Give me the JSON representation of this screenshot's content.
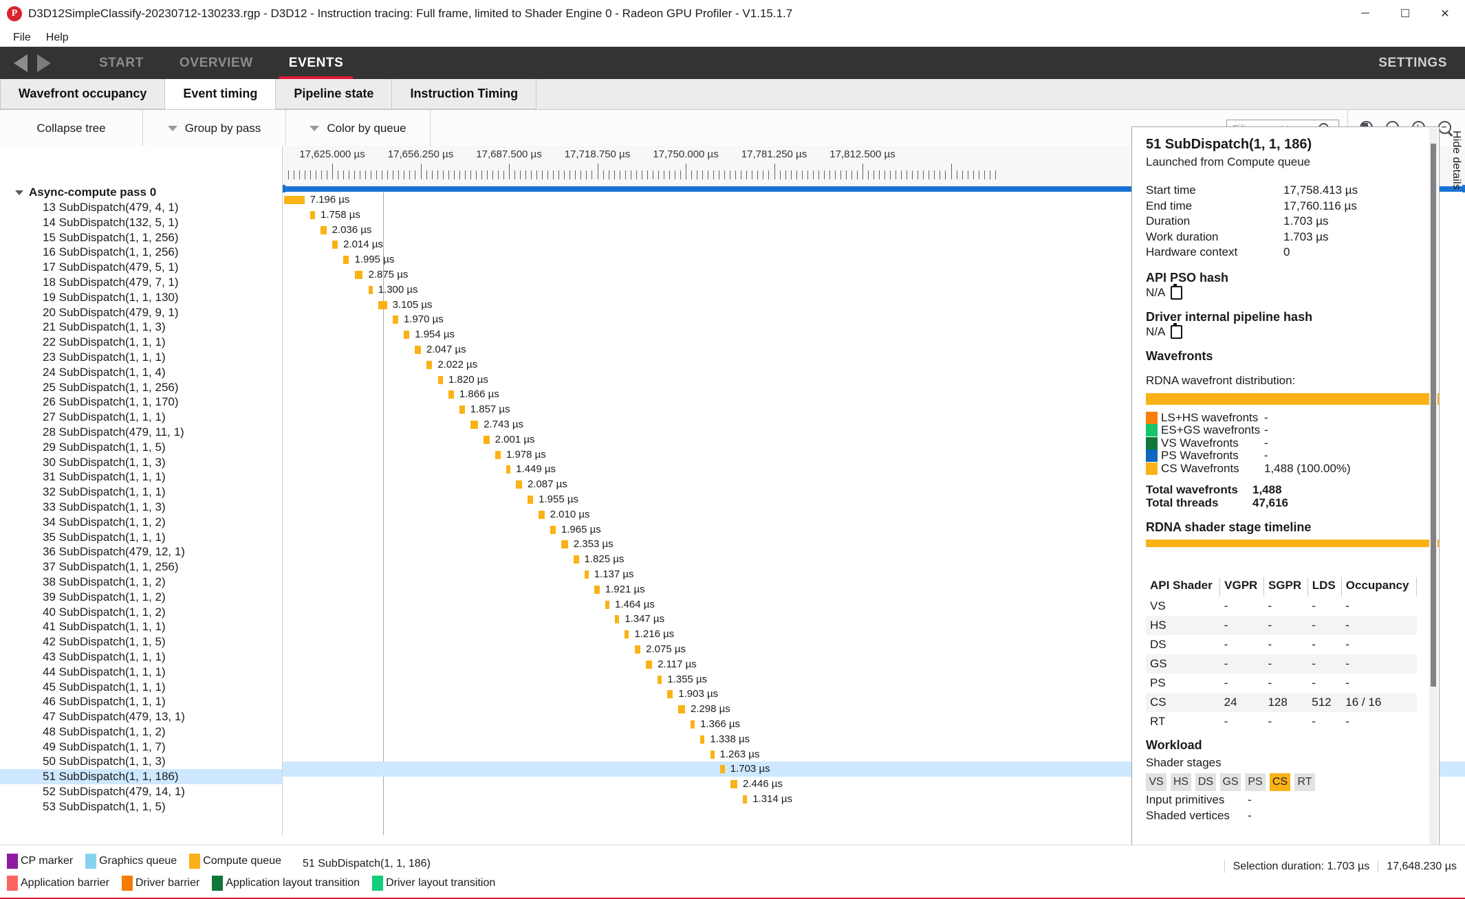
{
  "window": {
    "title": "D3D12SimpleClassify-20230712-130233.rgp - D3D12 - Instruction tracing: Full frame, limited to Shader Engine 0 - Radeon GPU Profiler - V1.15.1.7",
    "logo_letter": "P",
    "minimize": "─",
    "maximize": "☐",
    "close": "✕"
  },
  "menu": {
    "items": [
      "File",
      "Help"
    ]
  },
  "nav": {
    "back_icon": "triangle-left",
    "forward_icon": "triangle-right",
    "tabs": [
      {
        "label": "START",
        "active": false
      },
      {
        "label": "OVERVIEW",
        "active": false
      },
      {
        "label": "EVENTS",
        "active": true
      }
    ],
    "settings": "SETTINGS",
    "accent": "#e31937"
  },
  "subtabs": [
    {
      "label": "Wavefront occupancy",
      "active": false
    },
    {
      "label": "Event timing",
      "active": true
    },
    {
      "label": "Pipeline state",
      "active": false
    },
    {
      "label": "Instruction Timing",
      "active": false
    }
  ],
  "toolbar": {
    "collapse_tree": "Collapse tree",
    "group_by": "Group by pass",
    "color_by": "Color by queue",
    "search_placeholder": "Filter event tree...",
    "search_value": "",
    "zoom_buttons": [
      "zoom-to-selection-icon",
      "zoom-to-fit-icon",
      "zoom-in-icon",
      "zoom-out-icon"
    ]
  },
  "tree": {
    "root": "Async-compute pass 0",
    "selected_index": 38,
    "items": [
      "13 SubDispatch(479, 4, 1)",
      "14 SubDispatch(132, 5, 1)",
      "15 SubDispatch(1, 1, 256)",
      "16 SubDispatch(1, 1, 256)",
      "17 SubDispatch(479, 5, 1)",
      "18 SubDispatch(479, 7, 1)",
      "19 SubDispatch(1, 1, 130)",
      "20 SubDispatch(479, 9, 1)",
      "21 SubDispatch(1, 1, 3)",
      "22 SubDispatch(1, 1, 1)",
      "23 SubDispatch(1, 1, 1)",
      "24 SubDispatch(1, 1, 4)",
      "25 SubDispatch(1, 1, 256)",
      "26 SubDispatch(1, 1, 170)",
      "27 SubDispatch(1, 1, 1)",
      "28 SubDispatch(479, 11, 1)",
      "29 SubDispatch(1, 1, 5)",
      "30 SubDispatch(1, 1, 3)",
      "31 SubDispatch(1, 1, 1)",
      "32 SubDispatch(1, 1, 1)",
      "33 SubDispatch(1, 1, 3)",
      "34 SubDispatch(1, 1, 2)",
      "35 SubDispatch(1, 1, 1)",
      "36 SubDispatch(479, 12, 1)",
      "37 SubDispatch(1, 1, 256)",
      "38 SubDispatch(1, 1, 2)",
      "39 SubDispatch(1, 1, 2)",
      "40 SubDispatch(1, 1, 2)",
      "41 SubDispatch(1, 1, 1)",
      "42 SubDispatch(1, 1, 5)",
      "43 SubDispatch(1, 1, 1)",
      "44 SubDispatch(1, 1, 1)",
      "45 SubDispatch(1, 1, 1)",
      "46 SubDispatch(1, 1, 1)",
      "47 SubDispatch(479, 13, 1)",
      "48 SubDispatch(1, 1, 2)",
      "49 SubDispatch(1, 1, 7)",
      "50 SubDispatch(1, 1, 3)",
      "51 SubDispatch(1, 1, 186)",
      "52 SubDispatch(479, 14, 1)",
      "53 SubDispatch(1, 1, 5)"
    ]
  },
  "timeline": {
    "ruler_labels": [
      "17,625.000 µs",
      "17,656.250 µs",
      "17,687.500 µs",
      "17,718.750 µs",
      "17,750.000 µs",
      "17,781.250 µs",
      "17,812.500 µs"
    ],
    "bar_color": "#fbb216",
    "range_color": "#1a73d4",
    "durations": [
      "7.196 µs",
      "1.758 µs",
      "2.036 µs",
      "2.014 µs",
      "1.995 µs",
      "2.875 µs",
      "1.300 µs",
      "3.105 µs",
      "1.970 µs",
      "1.954 µs",
      "2.047 µs",
      "2.022 µs",
      "1.820 µs",
      "1.866 µs",
      "1.857 µs",
      "2.743 µs",
      "2.001 µs",
      "1.978 µs",
      "1.449 µs",
      "2.087 µs",
      "1.955 µs",
      "2.010 µs",
      "1.965 µs",
      "2.353 µs",
      "1.825 µs",
      "1.137 µs",
      "1.921 µs",
      "1.464 µs",
      "1.347 µs",
      "1.216 µs",
      "2.075 µs",
      "2.117 µs",
      "1.355 µs",
      "1.903 µs",
      "2.298 µs",
      "1.366 µs",
      "1.338 µs",
      "1.263 µs",
      "1.703 µs",
      "2.446 µs",
      "1.314 µs"
    ]
  },
  "details": {
    "title": "51 SubDispatch(1, 1, 186)",
    "subtitle": "Launched from Compute queue",
    "fields": [
      {
        "label": "Start time",
        "value": "17,758.413 µs"
      },
      {
        "label": "End time",
        "value": "17,760.116 µs"
      },
      {
        "label": "Duration",
        "value": "1.703 µs"
      },
      {
        "label": "Work duration",
        "value": "1.703 µs"
      },
      {
        "label": "Hardware context",
        "value": "0"
      }
    ],
    "api_pso_hash_label": "API PSO hash",
    "api_pso_hash_value": "N/A",
    "driver_hash_label": "Driver internal pipeline hash",
    "driver_hash_value": "N/A",
    "wavefronts_header": "Wavefronts",
    "distribution_label": "RDNA wavefront distribution:",
    "wavefront_legend": [
      {
        "color": "#f87f09",
        "name": "LS+HS wavefronts",
        "value": "-"
      },
      {
        "color": "#14c46a",
        "name": "ES+GS wavefronts",
        "value": "-"
      },
      {
        "color": "#10773a",
        "name": "VS Wavefronts",
        "value": "-"
      },
      {
        "color": "#0b68bd",
        "name": "PS Wavefronts",
        "value": "-"
      },
      {
        "color": "#fbb216",
        "name": "CS Wavefronts",
        "value": "1,488 (100.00%)"
      }
    ],
    "totals": [
      {
        "label": "Total wavefronts",
        "value": "1,488"
      },
      {
        "label": "Total threads",
        "value": "47,616"
      }
    ],
    "stage_timeline_header": "RDNA shader stage timeline",
    "shader_table": {
      "columns": [
        "API Shader",
        "VGPR",
        "SGPR",
        "LDS",
        "Occupancy"
      ],
      "rows": [
        [
          "VS",
          "-",
          "-",
          "-",
          "-"
        ],
        [
          "HS",
          "-",
          "-",
          "-",
          "-"
        ],
        [
          "DS",
          "-",
          "-",
          "-",
          "-"
        ],
        [
          "GS",
          "-",
          "-",
          "-",
          "-"
        ],
        [
          "PS",
          "-",
          "-",
          "-",
          "-"
        ],
        [
          "CS",
          "24",
          "128",
          "512",
          "16 / 16"
        ],
        [
          "RT",
          "-",
          "-",
          "-",
          "-"
        ]
      ]
    },
    "workload_header": "Workload",
    "shader_stages_label": "Shader stages",
    "stage_chips": [
      {
        "label": "VS",
        "active": false
      },
      {
        "label": "HS",
        "active": false
      },
      {
        "label": "DS",
        "active": false
      },
      {
        "label": "GS",
        "active": false
      },
      {
        "label": "PS",
        "active": false
      },
      {
        "label": "CS",
        "active": true
      },
      {
        "label": "RT",
        "active": false
      }
    ],
    "workload_rows": [
      {
        "label": "Input primitives",
        "value": "-"
      },
      {
        "label": "Shaded vertices",
        "value": "-"
      }
    ],
    "hide_details": "Hide details"
  },
  "bottom": {
    "legend_row1": [
      {
        "color": "#8e1ba0",
        "label": "CP marker"
      },
      {
        "color": "#85d3ef",
        "label": "Graphics queue"
      },
      {
        "color": "#fbb216",
        "label": "Compute queue"
      }
    ],
    "legend_row2": [
      {
        "color": "#fc6464",
        "label": "Application barrier"
      },
      {
        "color": "#f57c07",
        "label": "Driver barrier"
      },
      {
        "color": "#12753a",
        "label": "Application layout transition"
      },
      {
        "color": "#11cf7a",
        "label": "Driver layout transition"
      }
    ],
    "selection_name": "51 SubDispatch(1, 1, 186)",
    "selection_duration": "Selection duration:  1.703 µs",
    "selection_time": "17,648.230 µs"
  }
}
